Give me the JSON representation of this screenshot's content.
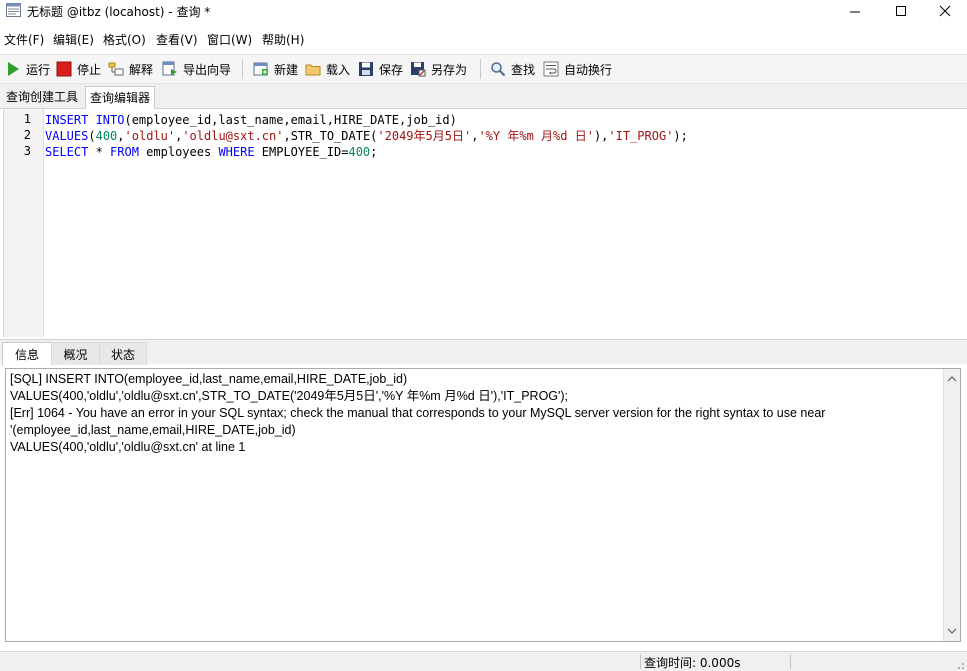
{
  "window": {
    "title": "无标题 @itbz (locahost) - 查询 *",
    "minimize_glyph": "─",
    "maximize_glyph": "☐",
    "close_glyph": "✕"
  },
  "menu": [
    "文件(F)",
    "编辑(E)",
    "格式(O)",
    "查看(V)",
    "窗口(W)",
    "帮助(H)"
  ],
  "toolbar": {
    "run": "运行",
    "stop": "停止",
    "explain": "解释",
    "export_wizard": "导出向导",
    "new": "新建",
    "load": "载入",
    "save": "保存",
    "save_as": "另存为",
    "find": "查找",
    "auto_wrap": "自动换行"
  },
  "query_tabs": [
    "查询创建工具",
    "查询编辑器"
  ],
  "editor": {
    "line_numbers": [
      "1",
      "2",
      "3"
    ],
    "lines": [
      [
        {
          "t": "INSERT INTO",
          "c": "kw"
        },
        {
          "t": "(employee_id,last_name,email,HIRE_DATE,job_id)",
          "c": "fn"
        }
      ],
      [
        {
          "t": "VALUES",
          "c": "kw"
        },
        {
          "t": "(",
          "c": "fn"
        },
        {
          "t": "400",
          "c": "num"
        },
        {
          "t": ",",
          "c": "fn"
        },
        {
          "t": "'oldlu'",
          "c": "str"
        },
        {
          "t": ",",
          "c": "fn"
        },
        {
          "t": "'oldlu@sxt.cn'",
          "c": "str"
        },
        {
          "t": ",STR_TO_DATE(",
          "c": "fn"
        },
        {
          "t": "'2049年5月5日'",
          "c": "str"
        },
        {
          "t": ",",
          "c": "fn"
        },
        {
          "t": "'%Y 年%m 月%d 日'",
          "c": "str"
        },
        {
          "t": "),",
          "c": "fn"
        },
        {
          "t": "'IT_PROG'",
          "c": "str"
        },
        {
          "t": ");",
          "c": "fn"
        }
      ],
      [
        {
          "t": "SELECT",
          "c": "kw"
        },
        {
          "t": " * ",
          "c": "fn"
        },
        {
          "t": "FROM",
          "c": "kw"
        },
        {
          "t": " employees ",
          "c": "fn"
        },
        {
          "t": "WHERE",
          "c": "kw"
        },
        {
          "t": " EMPLOYEE_ID=",
          "c": "fn"
        },
        {
          "t": "400",
          "c": "num"
        },
        {
          "t": ";",
          "c": "fn"
        }
      ]
    ]
  },
  "result_tabs": [
    "信息",
    "概况",
    "状态"
  ],
  "messages": [
    "[SQL] INSERT INTO(employee_id,last_name,email,HIRE_DATE,job_id)",
    "VALUES(400,'oldlu','oldlu@sxt.cn',STR_TO_DATE('2049年5月5日','%Y 年%m 月%d 日'),'IT_PROG');",
    "[Err] 1064 - You have an error in your SQL syntax; check the manual that corresponds to your MySQL server version for the right syntax to use near",
    "'(employee_id,last_name,email,HIRE_DATE,job_id)",
    "VALUES(400,'oldlu','oldlu@sxt.cn' at line 1"
  ],
  "status": {
    "query_time": "查询时间: 0.000s"
  },
  "colors": {
    "keyword": "#0000ff",
    "string": "#a31515",
    "number": "#098658",
    "run_green": "#2e9e2e",
    "stop_red": "#d91e1e"
  }
}
